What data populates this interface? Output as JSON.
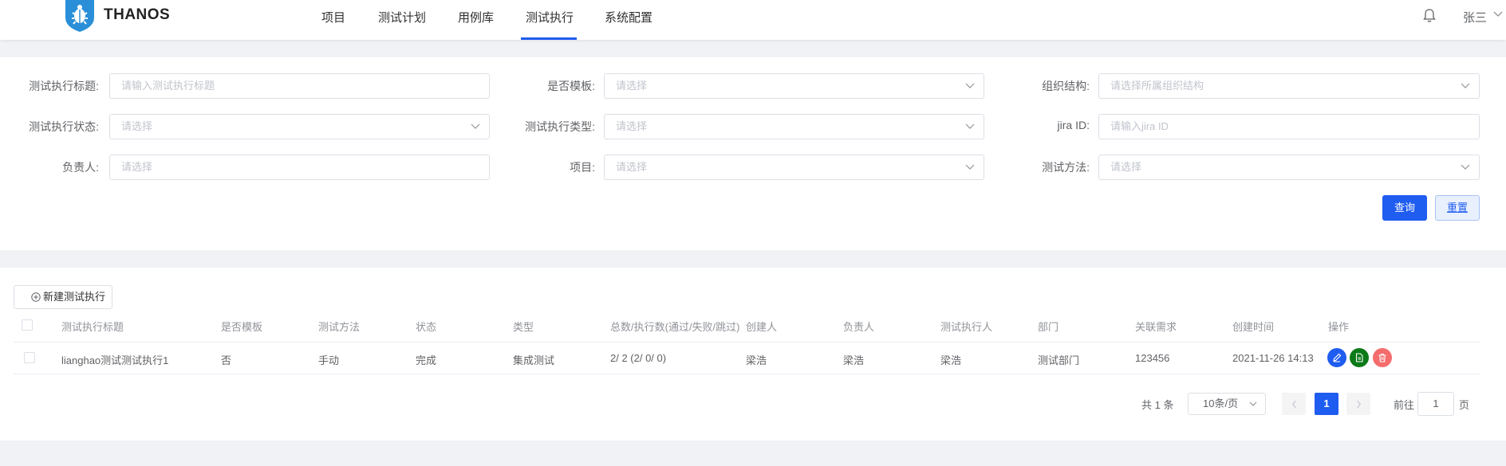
{
  "header": {
    "logo_text": "THANOS",
    "nav": [
      "项目",
      "测试计划",
      "用例库",
      "测试执行",
      "系统配置"
    ],
    "active_nav": "测试执行",
    "user_name": "张三"
  },
  "filters": {
    "title_label": "测试执行标题:",
    "title_placeholder": "请输入测试执行标题",
    "template_label": "是否模板:",
    "template_placeholder": "请选择",
    "org_label": "组织结构:",
    "org_placeholder": "请选择所属组织结构",
    "status_label": "测试执行状态:",
    "status_placeholder": "请选择",
    "type_label": "测试执行类型:",
    "type_placeholder": "请选择",
    "jira_label": "jira ID:",
    "jira_placeholder": "请输入jira ID",
    "owner_label": "负责人:",
    "owner_placeholder": "请选择",
    "project_label": "项目:",
    "project_placeholder": "请选择",
    "method_label": "测试方法:",
    "method_placeholder": "请选择",
    "query_label": "查询",
    "reset_label": "重置"
  },
  "table": {
    "new_button_label": "新建测试执行",
    "columns": [
      "测试执行标题",
      "是否模板",
      "测试方法",
      "状态",
      "类型",
      "总数/执行数(通过/失败/跳过)",
      "创建人",
      "负责人",
      "测试执行人",
      "部门",
      "关联需求",
      "创建时间",
      "操作"
    ],
    "rows": [
      [
        "lianghao测试测试执行1",
        "否",
        "手动",
        "完成",
        "集成测试",
        "2/ 2 (2/ 0/ 0)",
        "梁浩",
        "梁浩",
        "梁浩",
        "测试部门",
        "123456",
        "2021-11-26 14:13"
      ]
    ],
    "actions": [
      "edit-icon",
      "document-icon",
      "delete-icon"
    ],
    "action_colors": [
      "#1f5cf0",
      "#0b7a17",
      "#f56c6c"
    ]
  },
  "pagination": {
    "total": "共 1 条",
    "page_size": "10条/页",
    "current_page": "1",
    "goto_label": "前往",
    "goto_value": "1",
    "goto_unit": "页"
  },
  "colors": {
    "primary": "#1f5cf0",
    "background": "#f0f2f5"
  }
}
